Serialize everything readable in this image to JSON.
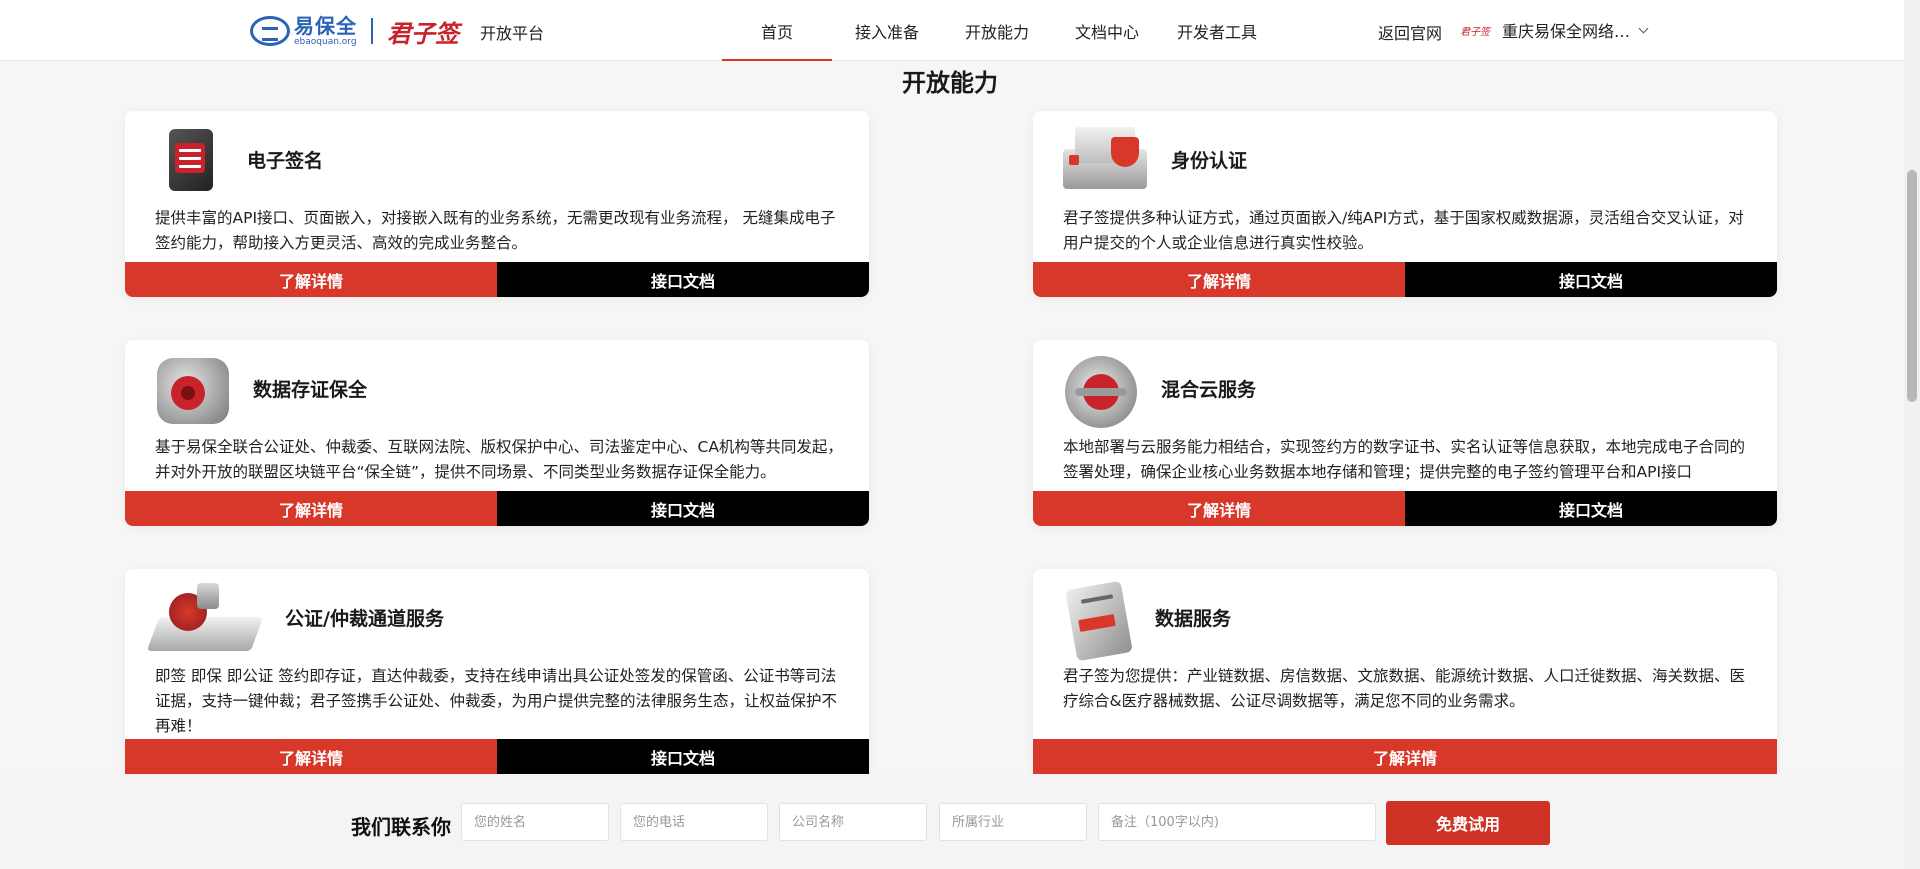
{
  "header": {
    "logo_cn": "易保全",
    "logo_en": "ebaoquan.org",
    "logo_jzq": "君子签",
    "platform": "开放平台",
    "nav": [
      "首页",
      "接入准备",
      "开放能力",
      "文档中心",
      "开发者工具"
    ],
    "active_index": 0,
    "back_home": "返回官网",
    "org_logo": "君子签",
    "org_name": "重庆易保全网络…"
  },
  "section_title": "开放能力",
  "cards": [
    {
      "title": "电子签名",
      "icon": "stamp-device-icon",
      "desc": "提供丰富的API接口、页面嵌入，对接嵌入既有的业务系统，无需更改现有业务流程， 无缝集成电子签约能力，帮助接入方更灵活、高效的完成业务整合。",
      "btn_detail": "了解详情",
      "btn_doc": "接口文档"
    },
    {
      "title": "身份认证",
      "icon": "id-verify-icon",
      "desc": "君子签提供多种认证方式，通过页面嵌入/纯API方式，基于国家权威数据源，灵活组合交叉认证，对用户提交的个人或企业信息进行真实性校验。",
      "btn_detail": "了解详情",
      "btn_doc": "接口文档"
    },
    {
      "title": "数据存证保全",
      "icon": "data-safe-icon",
      "desc": "基于易保全联合公证处、仲裁委、互联网法院、版权保护中心、司法鉴定中心、CA机构等共同发起，并对外开放的联盟区块链平台“保全链”，提供不同场景、不同类型业务数据存证保全能力。",
      "btn_detail": "了解详情",
      "btn_doc": "接口文档"
    },
    {
      "title": "混合云服务",
      "icon": "hybrid-cloud-icon",
      "desc": "本地部署与云服务能力相结合，实现签约方的数字证书、实名认证等信息获取，本地完成电子合同的签署处理，确保企业核心业务数据本地存储和管理；提供完整的电子签约管理平台和API接口",
      "btn_detail": "了解详情",
      "btn_doc": "接口文档"
    },
    {
      "title": "公证/仲裁通道服务",
      "icon": "notary-seal-icon",
      "desc": "即签 即保 即公证 签约即存证，直达仲裁委，支持在线申请出具公证处签发的保管函、公证书等司法证据，支持一键仲裁；君子签携手公证处、仲裁委，为用户提供完整的法律服务生态，让权益保护不再难！",
      "btn_detail": "了解详情",
      "btn_doc": "接口文档"
    },
    {
      "title": "数据服务",
      "icon": "data-service-icon",
      "desc": "君子签为您提供：产业链数据、房信数据、文旅数据、能源统计数据、人口迁徙数据、海关数据、医疗综合&医疗器械数据、公证尽调数据等，满足您不同的业务需求。",
      "btn_detail": "了解详情"
    }
  ],
  "contact": {
    "title": "我们联系你",
    "name_placeholder": "您的姓名",
    "phone_placeholder": "您的电话",
    "company_placeholder": "公司名称",
    "industry_placeholder": "所属行业",
    "remark_placeholder": "备注（100字以内)",
    "submit": "免费试用"
  },
  "colors": {
    "accent": "#d8382a",
    "dark": "#000000"
  }
}
